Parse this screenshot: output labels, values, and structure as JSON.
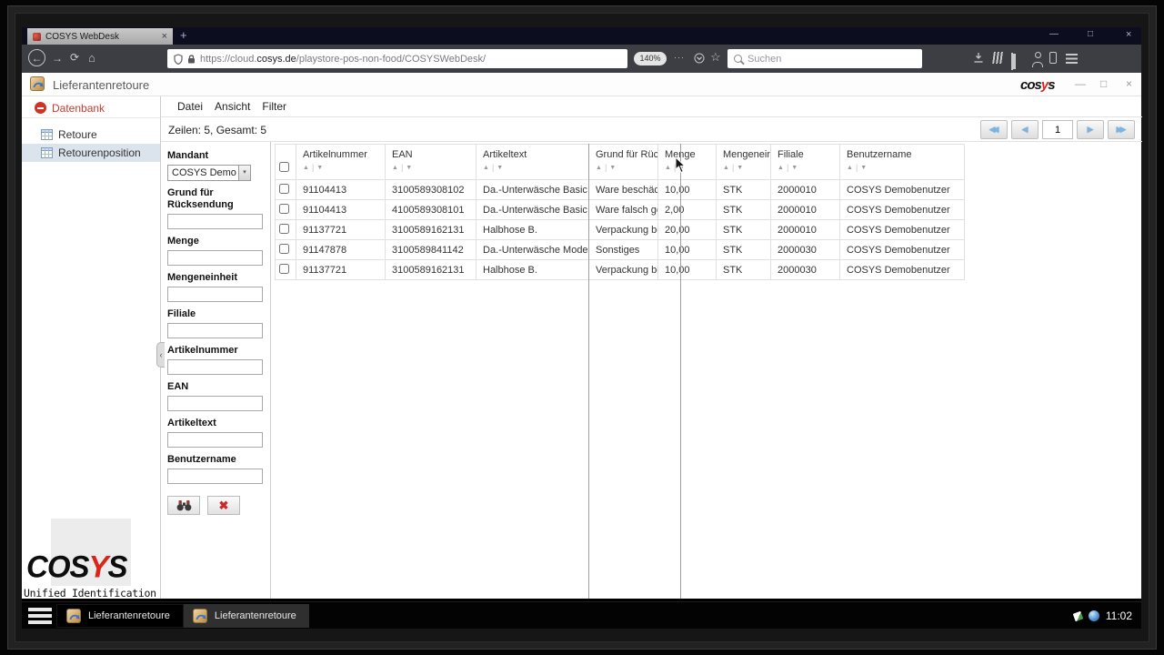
{
  "browser": {
    "tab_title": "COSYS WebDesk",
    "tab_close_icon": "×",
    "new_tab_icon": "+",
    "window_controls": {
      "minimize": "—",
      "maximize": "□",
      "close": "×"
    },
    "back_icon": "←",
    "forward_icon": "→",
    "reload_icon": "⟳",
    "home_icon": "⌂",
    "url_prefix": "https://cloud.",
    "url_domain": "cosys.de",
    "url_path": "/playstore-pos-non-food/COSYSWebDesk/",
    "zoom_badge": "140%",
    "overflow_icon": "···",
    "star_icon": "☆",
    "search_placeholder": "Suchen"
  },
  "app": {
    "title": "Lieferantenretoure",
    "brand_pre": "cos",
    "brand_y": "y",
    "brand_post": "s",
    "window_controls": {
      "minimize": "—",
      "maximize": "□",
      "close": "×"
    },
    "menu": [
      "Datei",
      "Ansicht",
      "Filter"
    ],
    "rows_summary": "Zeilen: 5, Gesamt: 5"
  },
  "pagination": {
    "first_icon": "◀◀",
    "prev_icon": "◀",
    "page": "1",
    "next_icon": "▶",
    "last_icon": "▶▶"
  },
  "sidebar": {
    "root_label": "Datenbank",
    "collapse_icon": "‹",
    "items": [
      {
        "label": "Retoure"
      },
      {
        "label": "Retourenposition",
        "selected": true
      }
    ]
  },
  "logo": {
    "text_pre": "COS",
    "text_y": "Y",
    "text_post": "S",
    "tagline": "Unified Identification"
  },
  "filters": {
    "mandant_label": "Mandant",
    "mandant_value": "COSYS Demo",
    "dropdown_icon": "▾",
    "fields": [
      {
        "label": "Grund für Rücksendung"
      },
      {
        "label": "Menge"
      },
      {
        "label": "Mengeneinheit"
      },
      {
        "label": "Filiale"
      },
      {
        "label": "Artikelnummer"
      },
      {
        "label": "EAN"
      },
      {
        "label": "Artikeltext"
      },
      {
        "label": "Benutzername"
      }
    ],
    "clear_icon": "✖"
  },
  "table": {
    "sort_asc_icon": "▲",
    "sort_desc_icon": "▼",
    "sort_sep": "|",
    "columns": [
      "Artikelnummer",
      "EAN",
      "Artikeltext",
      "Grund für Rück",
      "Menge",
      "Mengeneinh",
      "Filiale",
      "Benutzername"
    ],
    "rows": [
      [
        "91104413",
        "3100589308102",
        "Da.-Unterwäsche Basic",
        "Ware beschädi",
        "10,00",
        "STK",
        "2000010",
        "COSYS Demobenutzer"
      ],
      [
        "91104413",
        "4100589308101",
        "Da.-Unterwäsche Basic",
        "Ware falsch ge",
        "2,00",
        "STK",
        "2000010",
        "COSYS Demobenutzer"
      ],
      [
        "91137721",
        "3100589162131",
        "Halbhose B.",
        "Verpackung be",
        "20,00",
        "STK",
        "2000010",
        "COSYS Demobenutzer"
      ],
      [
        "91147878",
        "3100589841142",
        "Da.-Unterwäsche Mode",
        "Sonstiges",
        "10,00",
        "STK",
        "2000030",
        "COSYS Demobenutzer"
      ],
      [
        "91137721",
        "3100589162131",
        "Halbhose B.",
        "Verpackung be",
        "10,00",
        "STK",
        "2000030",
        "COSYS Demobenutzer"
      ]
    ]
  },
  "taskbar": {
    "items": [
      "Lieferantenretoure",
      "Lieferantenretoure"
    ],
    "time": "11:02"
  }
}
